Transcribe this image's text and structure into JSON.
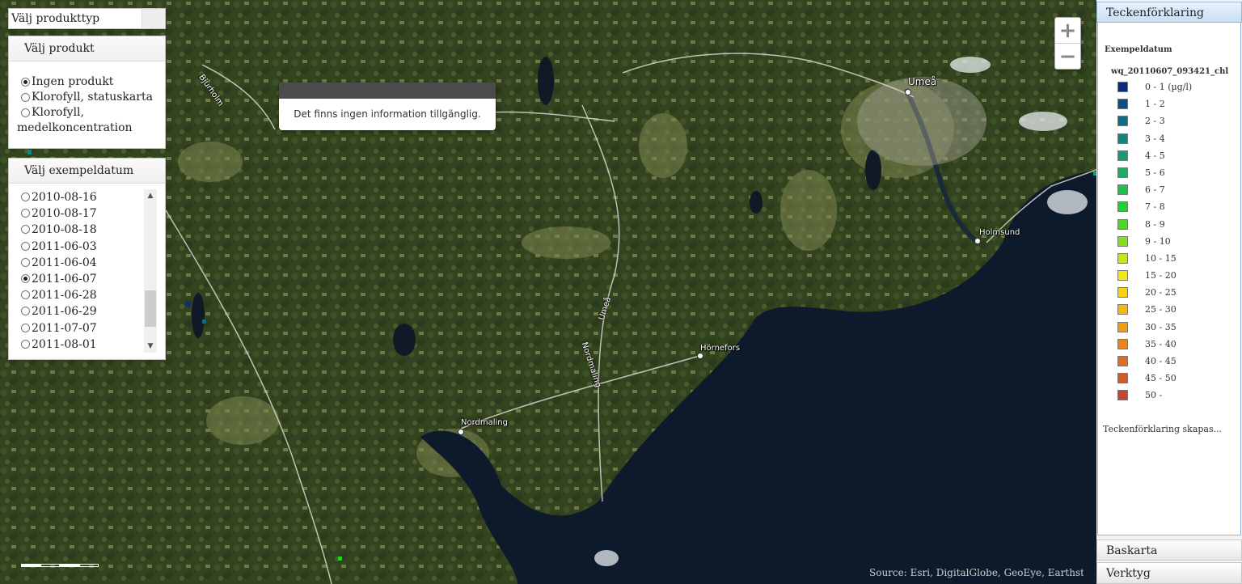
{
  "product_type": {
    "label": "Välj produkttyp"
  },
  "choose_product": {
    "title": "Välj produkt",
    "options": [
      {
        "label": "Ingen produkt",
        "selected": true
      },
      {
        "label": "Klorofyll, statuskarta",
        "selected": false
      },
      {
        "label_line1": "Klorofyll,",
        "label_line2": "medelkoncentration",
        "selected": false
      }
    ]
  },
  "choose_date": {
    "title": "Välj exempeldatum",
    "dates": [
      "2010-08-16",
      "2010-08-17",
      "2010-08-18",
      "2011-06-03",
      "2011-06-04",
      "2011-06-07",
      "2011-06-28",
      "2011-06-29",
      "2011-07-07",
      "2011-08-01"
    ],
    "selected_index": 5
  },
  "popup": {
    "message": "Det finns ingen information tillgänglig."
  },
  "zoom": {
    "in_symbol": "+",
    "out_symbol": "−"
  },
  "map": {
    "places": [
      "Umeå",
      "Holmsund",
      "Hörnefors",
      "Nordmaling"
    ],
    "roads": [
      "Bjurholm",
      "Umeå",
      "Nordmaling"
    ],
    "attribution": "Source: Esri, DigitalGlobe, GeoEye, Earthstar G..."
  },
  "right_panel": {
    "legend_tab": "Teckenförklaring",
    "basemap_tab": "Baskarta",
    "tools_tab": "Verktyg",
    "section_title": "Exempeldatum",
    "layer_name": "wq_20110607_093421_chl",
    "status": "Teckenförklaring skapas...",
    "items": [
      {
        "label": "0 - 1 (µg/l)",
        "color": "#0a2a7a"
      },
      {
        "label": "1 - 2",
        "color": "#0b4f8a"
      },
      {
        "label": "2 - 3",
        "color": "#0d6b86"
      },
      {
        "label": "3 - 4",
        "color": "#11857f"
      },
      {
        "label": "4 - 5",
        "color": "#169a78"
      },
      {
        "label": "5 - 6",
        "color": "#1aae67"
      },
      {
        "label": "6 - 7",
        "color": "#1ec24a"
      },
      {
        "label": "7 - 8",
        "color": "#22d22a"
      },
      {
        "label": "8 - 9",
        "color": "#4cd81e"
      },
      {
        "label": "9 - 10",
        "color": "#86df1a"
      },
      {
        "label": "10 - 15",
        "color": "#c4e616"
      },
      {
        "label": "15 - 20",
        "color": "#f4ea10"
      },
      {
        "label": "20 - 25",
        "color": "#f8d20e"
      },
      {
        "label": "25 - 30",
        "color": "#f6b80e"
      },
      {
        "label": "30 - 35",
        "color": "#ef9e12"
      },
      {
        "label": "35 - 40",
        "color": "#e88618"
      },
      {
        "label": "40 - 45",
        "color": "#df6e1e"
      },
      {
        "label": "45 - 50",
        "color": "#d55a26"
      },
      {
        "label": "50 -",
        "color": "#c9442c"
      }
    ]
  }
}
